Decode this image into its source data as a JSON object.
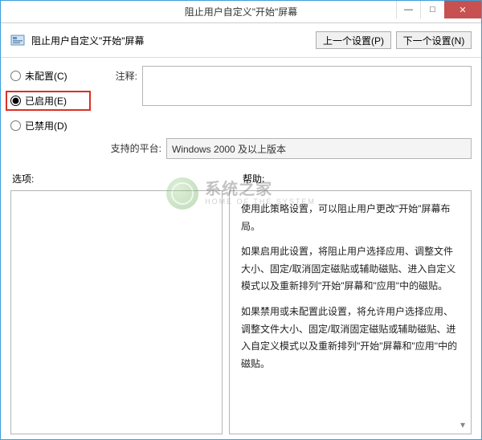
{
  "window": {
    "title": "阻止用户自定义\"开始\"屏幕",
    "controls": {
      "min": "—",
      "max": "□",
      "close": "✕"
    }
  },
  "header": {
    "caption": "阻止用户自定义\"开始\"屏幕",
    "prev_btn": "上一个设置(P)",
    "next_btn": "下一个设置(N)"
  },
  "radios": {
    "not_configured": "未配置(C)",
    "enabled": "已启用(E)",
    "disabled": "已禁用(D)",
    "selected": "enabled"
  },
  "fields": {
    "comment_label": "注释:",
    "comment_value": "",
    "platform_label": "支持的平台:",
    "platform_value": "Windows 2000 及以上版本"
  },
  "section_labels": {
    "options": "选项:",
    "help": "帮助:"
  },
  "help_paragraphs": [
    "使用此策略设置，可以阻止用户更改\"开始\"屏幕布局。",
    "如果启用此设置，将阻止用户选择应用、调整文件大小、固定/取消固定磁贴或辅助磁贴、进入自定义模式以及重新排列\"开始\"屏幕和\"应用\"中的磁贴。",
    "如果禁用或未配置此设置，将允许用户选择应用、调整文件大小、固定/取消固定磁贴或辅助磁贴、进入自定义模式以及重新排列\"开始\"屏幕和\"应用\"中的磁贴。"
  ],
  "watermark": {
    "cn": "系统之家",
    "en": "HOME OF THE SYSTEM"
  }
}
